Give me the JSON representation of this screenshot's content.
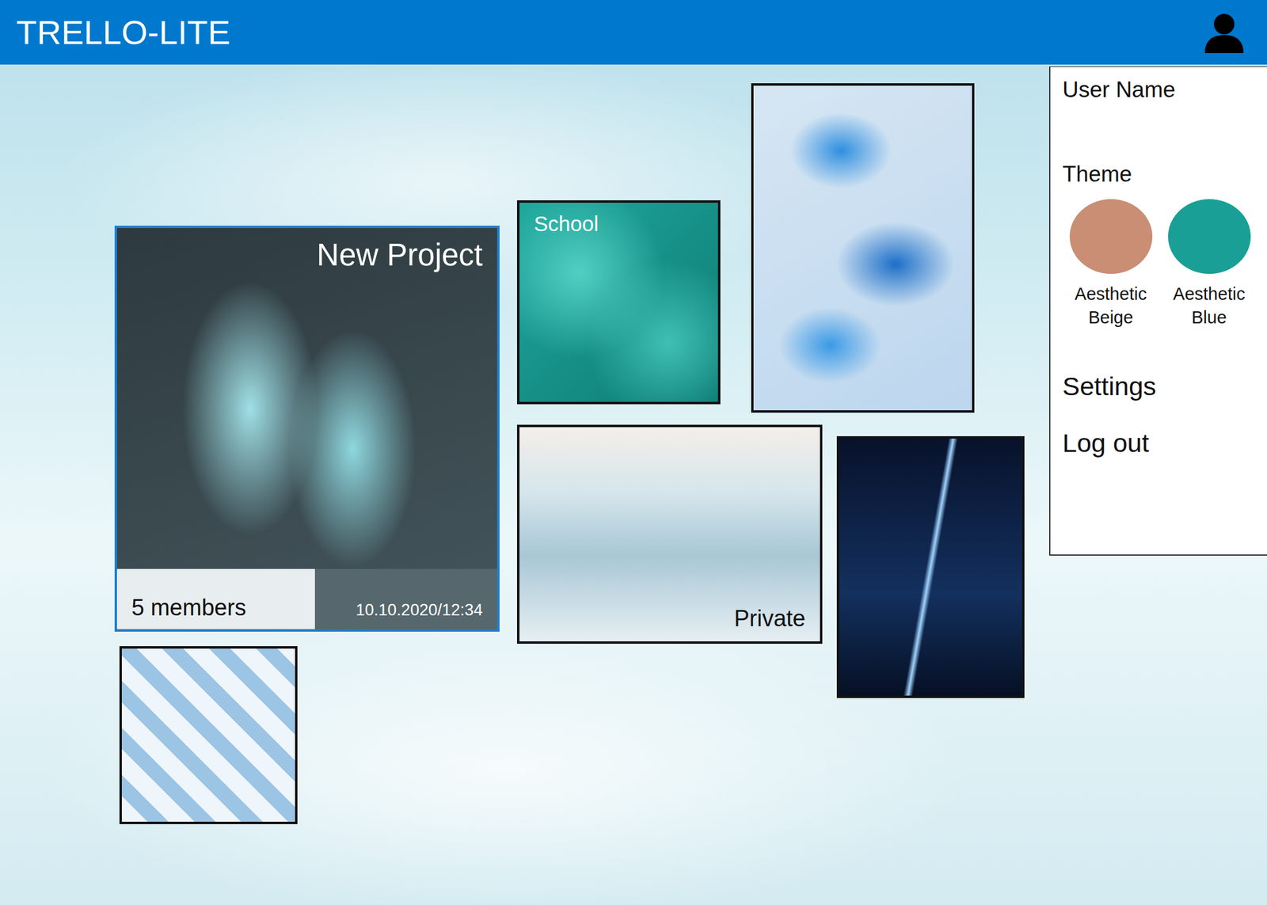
{
  "app": {
    "title": "TRELLO-LITE"
  },
  "user_menu": {
    "user_name": "User Name",
    "theme_heading": "Theme",
    "themes": [
      {
        "label": "Aesthetic Beige",
        "color": "#c98e74"
      },
      {
        "label": "Aesthetic Blue",
        "color": "#1a9f96"
      }
    ],
    "items": [
      "Settings",
      "Log out"
    ]
  },
  "boards": [
    {
      "label": "New Project",
      "members": "5 members",
      "date": "10.10.2020/12:34",
      "selected": true
    },
    {
      "label": "School",
      "selected": false
    },
    {
      "selected": false
    },
    {
      "label": "Private",
      "selected": false
    },
    {
      "selected": false
    },
    {
      "selected": false
    }
  ]
}
